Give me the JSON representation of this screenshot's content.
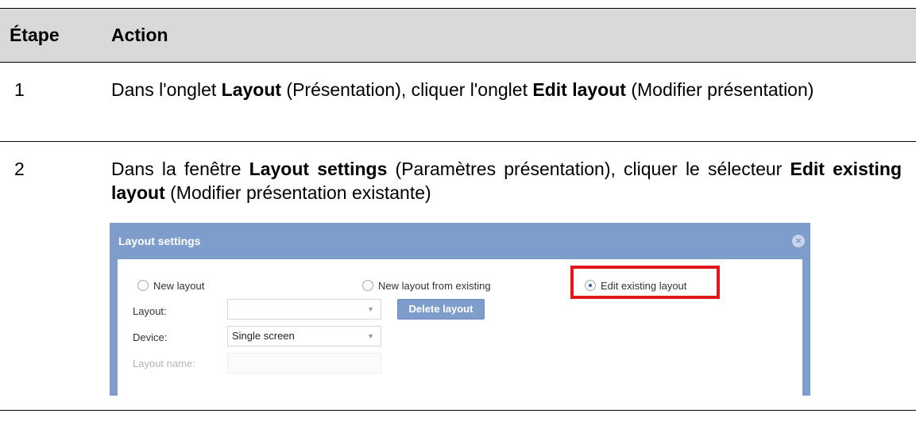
{
  "table": {
    "headers": {
      "step": "Étape",
      "action": "Action"
    },
    "rows": [
      {
        "step": "1",
        "text": [
          {
            "t": "Dans l'onglet ",
            "bold": false
          },
          {
            "t": "Layout",
            "bold": true
          },
          {
            "t": " (Présentation), cliquer l'onglet ",
            "bold": false
          },
          {
            "t": "Edit layout",
            "bold": true
          },
          {
            "t": " (Modifier présentation)",
            "bold": false
          }
        ]
      },
      {
        "step": "2",
        "text": [
          {
            "t": "Dans la fenêtre ",
            "bold": false
          },
          {
            "t": "Layout settings",
            "bold": true
          },
          {
            "t": " (Paramètres présentation), cliquer le sélecteur ",
            "bold": false
          },
          {
            "t": "Edit existing layout",
            "bold": true
          },
          {
            "t": " (Modifier présentation existante)",
            "bold": false
          }
        ]
      }
    ]
  },
  "dialog": {
    "title": "Layout settings",
    "close_icon": "close-circle-icon",
    "radios": {
      "new_layout": "New layout",
      "new_from_existing": "New layout from existing",
      "edit_existing": "Edit existing layout",
      "selected": "edit_existing"
    },
    "layout_label": "Layout:",
    "layout_value": "",
    "delete_button": "Delete layout",
    "device_label": "Device:",
    "device_value": "Single screen",
    "layout_name_label": "Layout name:",
    "layout_name_value": "",
    "highlight_color": "#e0171c",
    "accent_color": "#7e9dcb"
  }
}
